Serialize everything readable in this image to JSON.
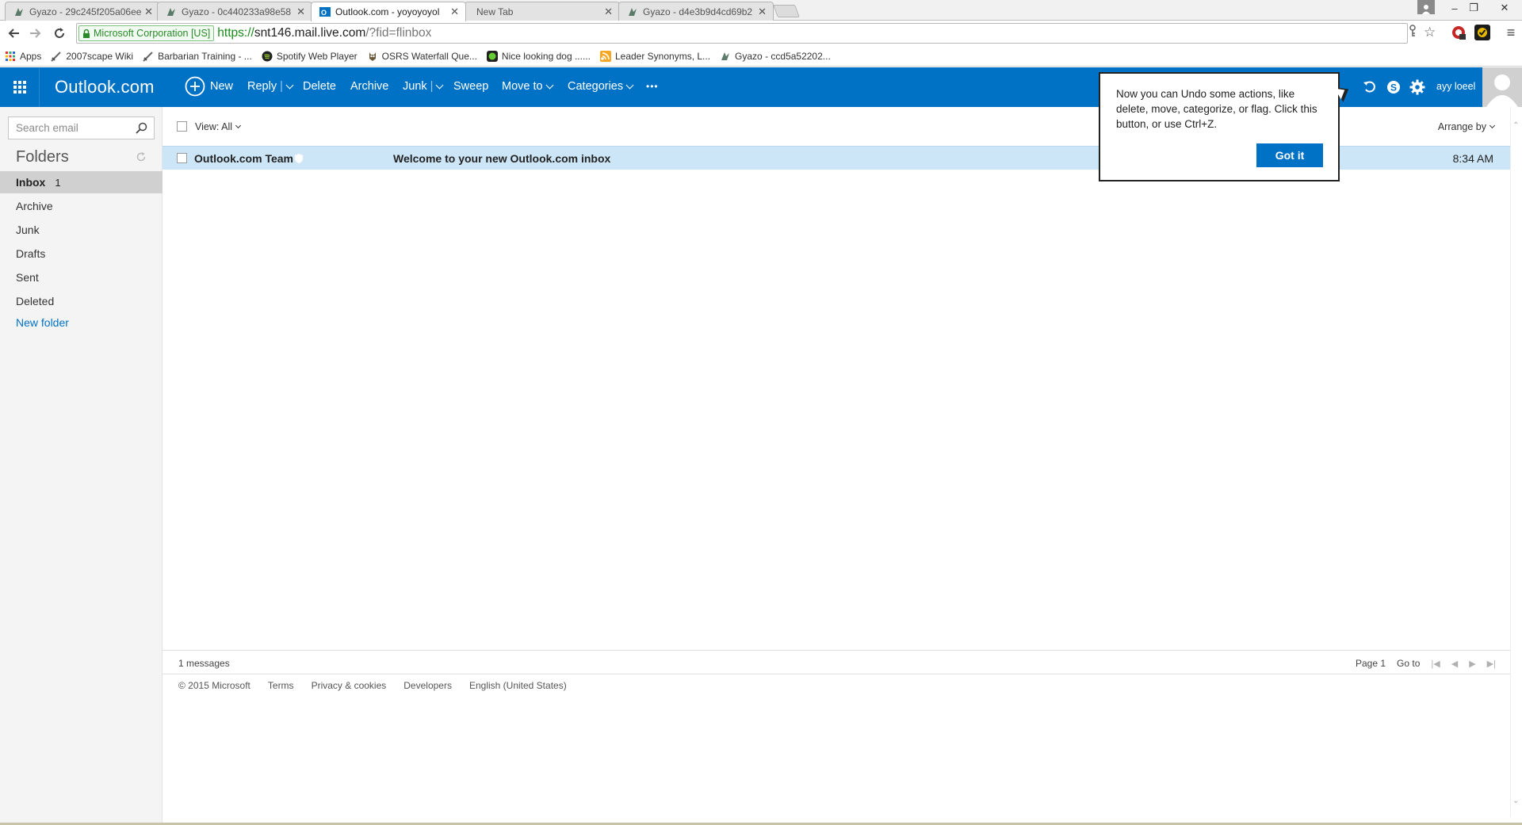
{
  "browser": {
    "tabs": [
      {
        "title": "Gyazo - 29c245f205a06ee",
        "icon": "gyazo-icon"
      },
      {
        "title": "Gyazo - 0c440233a98e58",
        "icon": "gyazo-icon"
      },
      {
        "title": "Outlook.com - yoyoyoyol",
        "icon": "outlook-icon",
        "active": true
      },
      {
        "title": "New Tab",
        "icon": ""
      },
      {
        "title": "Gyazo - d4e3b9d4cd69b2",
        "icon": "gyazo-icon"
      }
    ],
    "address": {
      "ev_label": "Microsoft Corporation [US]",
      "scheme": "https://",
      "host": "snt146.mail.live.com",
      "path": "/?fid=flinbox"
    },
    "bookmarks": [
      {
        "label": "Apps",
        "icon": "apps-grid-icon"
      },
      {
        "label": "2007scape Wiki",
        "icon": "sword-icon"
      },
      {
        "label": "Barbarian Training - ...",
        "icon": "sword-icon"
      },
      {
        "label": "Spotify Web Player",
        "icon": "spotify-icon"
      },
      {
        "label": "OSRS Waterfall Que...",
        "icon": "owl-icon"
      },
      {
        "label": "Nice looking dog ......",
        "icon": "green-circle-icon"
      },
      {
        "label": "Leader Synonyms, L...",
        "icon": "rss-icon"
      },
      {
        "label": "Gyazo - ccd5a52202...",
        "icon": "gyazo-icon"
      }
    ]
  },
  "outlook": {
    "brand": "Outlook.com",
    "commands": {
      "new": "New",
      "reply": "Reply",
      "delete": "Delete",
      "archive": "Archive",
      "junk": "Junk",
      "sweep": "Sweep",
      "move_to": "Move to",
      "categories": "Categories",
      "more": "•••"
    },
    "user_name": "ayy loeel",
    "search_placeholder": "Search email",
    "folders_title": "Folders",
    "folders": [
      {
        "label": "Inbox",
        "count": "1",
        "selected": true
      },
      {
        "label": "Archive"
      },
      {
        "label": "Junk"
      },
      {
        "label": "Drafts"
      },
      {
        "label": "Sent"
      },
      {
        "label": "Deleted"
      }
    ],
    "new_folder": "New folder",
    "view_filter": "View: All",
    "arrange_by": "Arrange by",
    "messages": [
      {
        "from": "Outlook.com Team",
        "subject": "Welcome to your new Outlook.com inbox",
        "time": "8:34 AM",
        "unread": true
      }
    ],
    "message_count": "1 messages",
    "pager": {
      "page": "Page 1",
      "goto": "Go to"
    },
    "footer_links": [
      "© 2015 Microsoft",
      "Terms",
      "Privacy & cookies",
      "Developers",
      "English (United States)"
    ],
    "undo_tip": {
      "text": "Now you can Undo some actions, like delete, move, categorize, or flag. Click this button, or use Ctrl+Z.",
      "button": "Got it"
    },
    "accent_color": "#0072c6"
  }
}
